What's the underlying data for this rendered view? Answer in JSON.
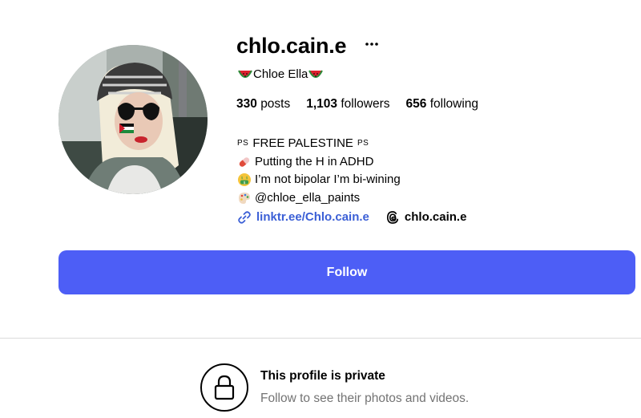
{
  "profile": {
    "username": "chlo.cain.e",
    "full_name": "Chloe Ella",
    "stats": {
      "posts_count": "330",
      "posts_label": "posts",
      "followers_count": "1,103",
      "followers_label": "followers",
      "following_count": "656",
      "following_label": "following"
    },
    "bio": {
      "line1_prefix": "PS",
      "line1_text": "FREE PALESTINE",
      "line1_suffix": "PS",
      "line2_text": "Putting the H in ADHD",
      "line3_text": "I’m not bipolar I’m bi-wining",
      "line4_text": "@chloe_ella_paints"
    },
    "external_link": "linktr.ee/Chlo.cain.e",
    "threads_handle": "chlo.cain.e"
  },
  "actions": {
    "follow_label": "Follow"
  },
  "private_notice": {
    "title": "This profile is private",
    "subtitle": "Follow to see their photos and videos."
  },
  "icons": {
    "more": "more-options-icon",
    "link": "link-icon",
    "threads": "threads-icon",
    "lock": "lock-icon",
    "watermelon": "watermelon-emoji",
    "pill": "pill-emoji",
    "money_face": "money-mouth-face-emoji",
    "palette": "artist-palette-emoji"
  },
  "colors": {
    "follow_button": "#4d5ef6",
    "link": "#3b5fd6",
    "secondary_text": "#737373",
    "divider": "#dbdbdb"
  }
}
